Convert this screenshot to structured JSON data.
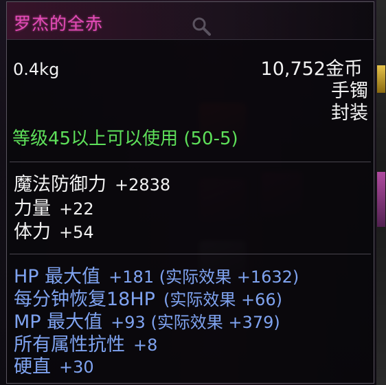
{
  "item": {
    "name": "罗杰的全赤",
    "weight": "0.4kg",
    "price": "10,752金币",
    "type": "手镯",
    "binding": "封装",
    "level_requirement": "等级45以上可以使用 (50-5)"
  },
  "base_stats": [
    {
      "label": "魔法防御力",
      "value": "+2838"
    },
    {
      "label": "力量",
      "value": "+22"
    },
    {
      "label": "体力",
      "value": "+54"
    }
  ],
  "bonus_stats": [
    {
      "label": "HP 最大值",
      "value": "+181 (实际效果 +1632)"
    },
    {
      "label": "每分钟恢复18HP",
      "value": "(实际效果 +66)"
    },
    {
      "label": "MP 最大值",
      "value": "+93 (实际效果 +379)"
    },
    {
      "label": "所有属性抗性",
      "value": "+8"
    },
    {
      "label": "硬直",
      "value": "+30"
    }
  ],
  "colors": {
    "name": "#e24bb7",
    "requirement": "#5ee05a",
    "bonus": "#7fa3f0",
    "text": "#f2f2f2"
  },
  "icons": {
    "search": "search-icon"
  }
}
